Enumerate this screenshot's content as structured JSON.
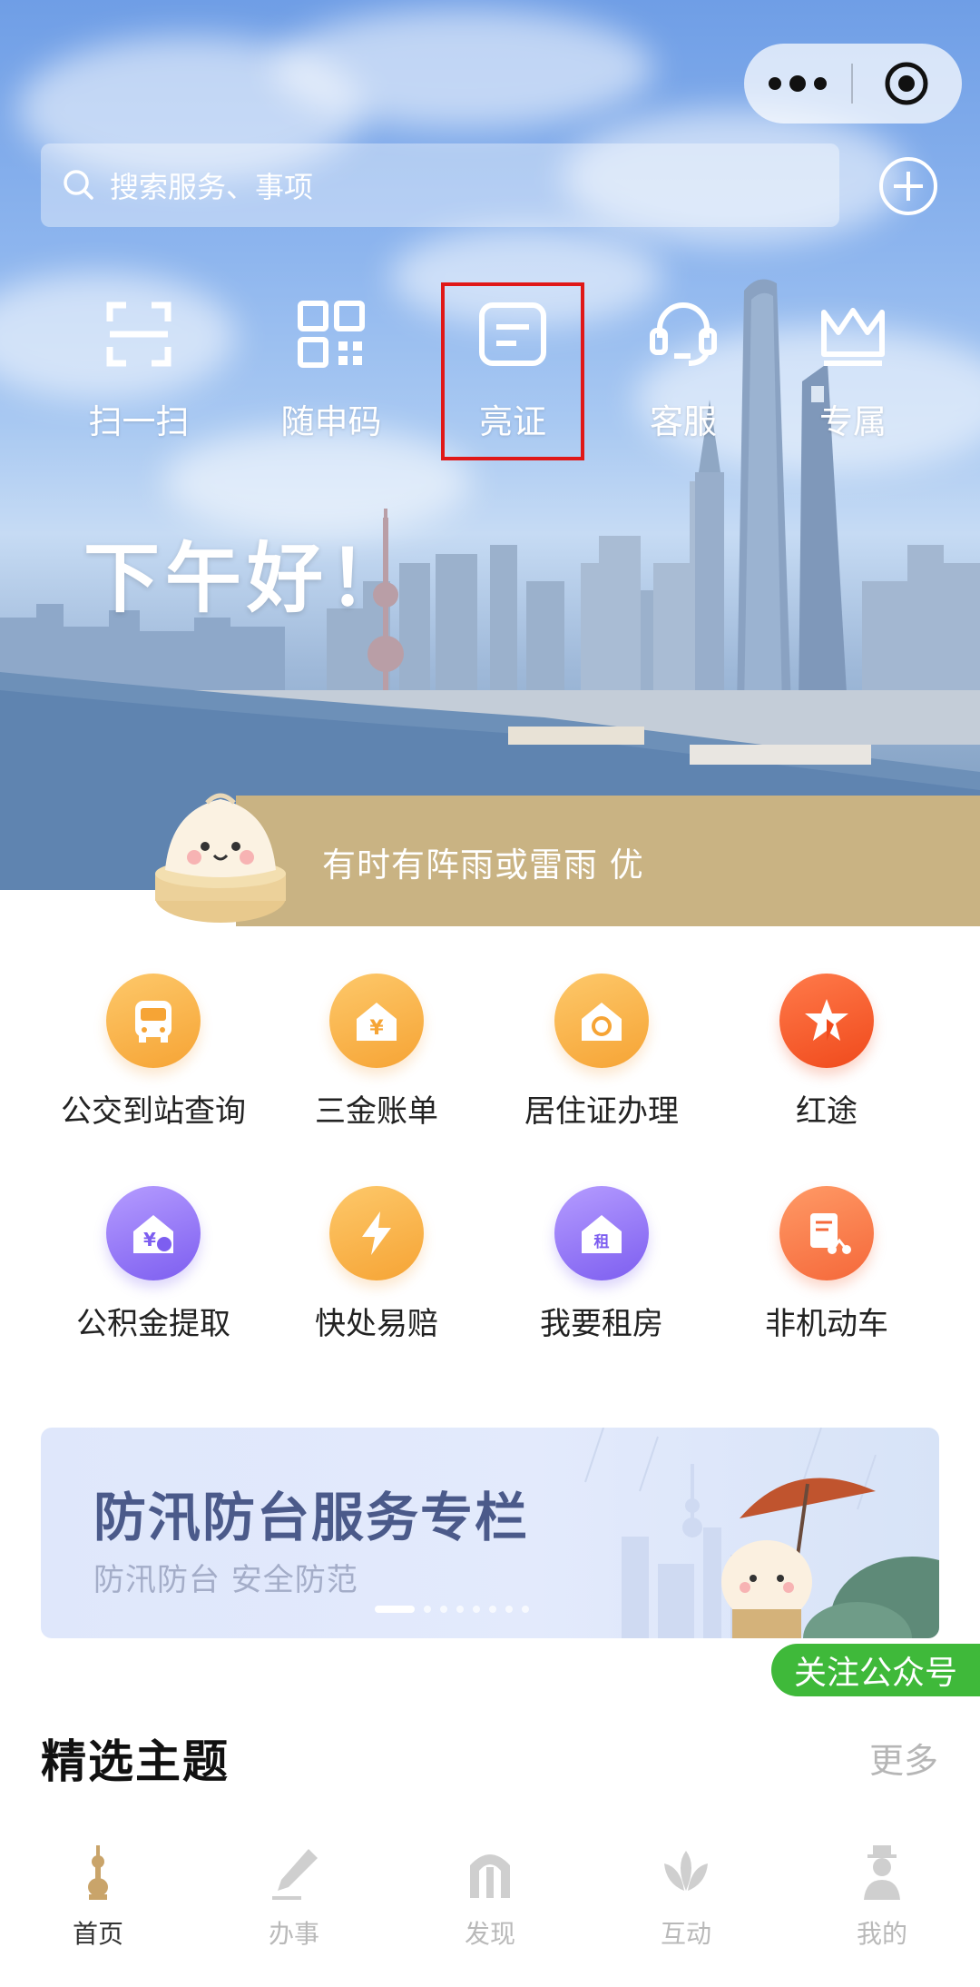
{
  "capsule": {
    "more_icon": "more-dots-icon",
    "close_icon": "target-circle-icon"
  },
  "search": {
    "placeholder": "搜索服务、事项"
  },
  "quick_actions": [
    {
      "label": "扫一扫",
      "icon": "scan-icon"
    },
    {
      "label": "随申码",
      "icon": "qr-code-icon"
    },
    {
      "label": "亮证",
      "icon": "id-card-icon"
    },
    {
      "label": "客服",
      "icon": "headset-icon"
    },
    {
      "label": "专属",
      "icon": "crown-icon"
    }
  ],
  "greeting": "下午好！",
  "weather": {
    "text": "有时有阵雨或雷雨 优"
  },
  "services": [
    {
      "label": "公交到站查询",
      "icon": "bus-icon",
      "color": "#f6a435"
    },
    {
      "label": "三金账单",
      "icon": "house-yen-icon",
      "color": "#f6a435"
    },
    {
      "label": "居住证办理",
      "icon": "house-badge-icon",
      "color": "#f6a435"
    },
    {
      "label": "红途",
      "icon": "star-flag-icon",
      "color": "#f04a1c"
    },
    {
      "label": "公积金提取",
      "icon": "house-fund-icon",
      "color": "#7d5ef0"
    },
    {
      "label": "快处易赔",
      "icon": "lightning-icon",
      "color": "#f6a435"
    },
    {
      "label": "我要租房",
      "icon": "house-rent-icon",
      "color": "#7d5ef0",
      "badge": "租"
    },
    {
      "label": "非机动车",
      "icon": "scooter-doc-icon",
      "color": "#f5683a"
    }
  ],
  "banner": {
    "title": "防汛防台服务专栏",
    "subtitle": "防汛防台 安全防范",
    "pages": 8,
    "active_page": 1
  },
  "follow_button": "关注公众号",
  "section": {
    "title": "精选主题",
    "more": "更多"
  },
  "tabs": [
    {
      "label": "首页",
      "icon": "tower-icon",
      "active": true
    },
    {
      "label": "办事",
      "icon": "pen-icon",
      "active": false
    },
    {
      "label": "发现",
      "icon": "arch-icon",
      "active": false
    },
    {
      "label": "互动",
      "icon": "lotus-icon",
      "active": false
    },
    {
      "label": "我的",
      "icon": "person-icon",
      "active": false
    }
  ],
  "colors": {
    "accent": "#c9b383",
    "highlight_border": "#e01818",
    "follow_green": "#3fb93a"
  }
}
